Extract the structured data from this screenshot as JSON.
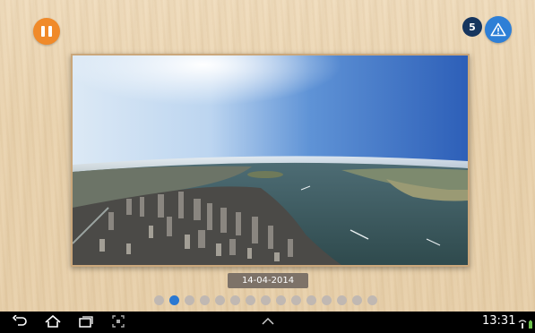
{
  "controls": {
    "pause_icon": "pause-icon",
    "alert_icon": "warning-triangle-icon",
    "badge_count": "5"
  },
  "photo": {
    "description_icon": "aerial-city-photo",
    "date": "14-04-2014"
  },
  "pager": {
    "total": 15,
    "active_index": 1
  },
  "system_bar": {
    "time": "13:31",
    "icons": [
      "back-icon",
      "home-icon",
      "recents-icon",
      "screenshot-icon",
      "chevron-up-icon",
      "wifi-icon",
      "battery-icon"
    ]
  },
  "colors": {
    "pause_button": "#f08a2a",
    "alert_button": "#2e7fd6",
    "badge": "#16355e",
    "active_dot": "#2a78d2",
    "inactive_dot": "#c0b8b2",
    "date_bg": "#7d7268"
  }
}
